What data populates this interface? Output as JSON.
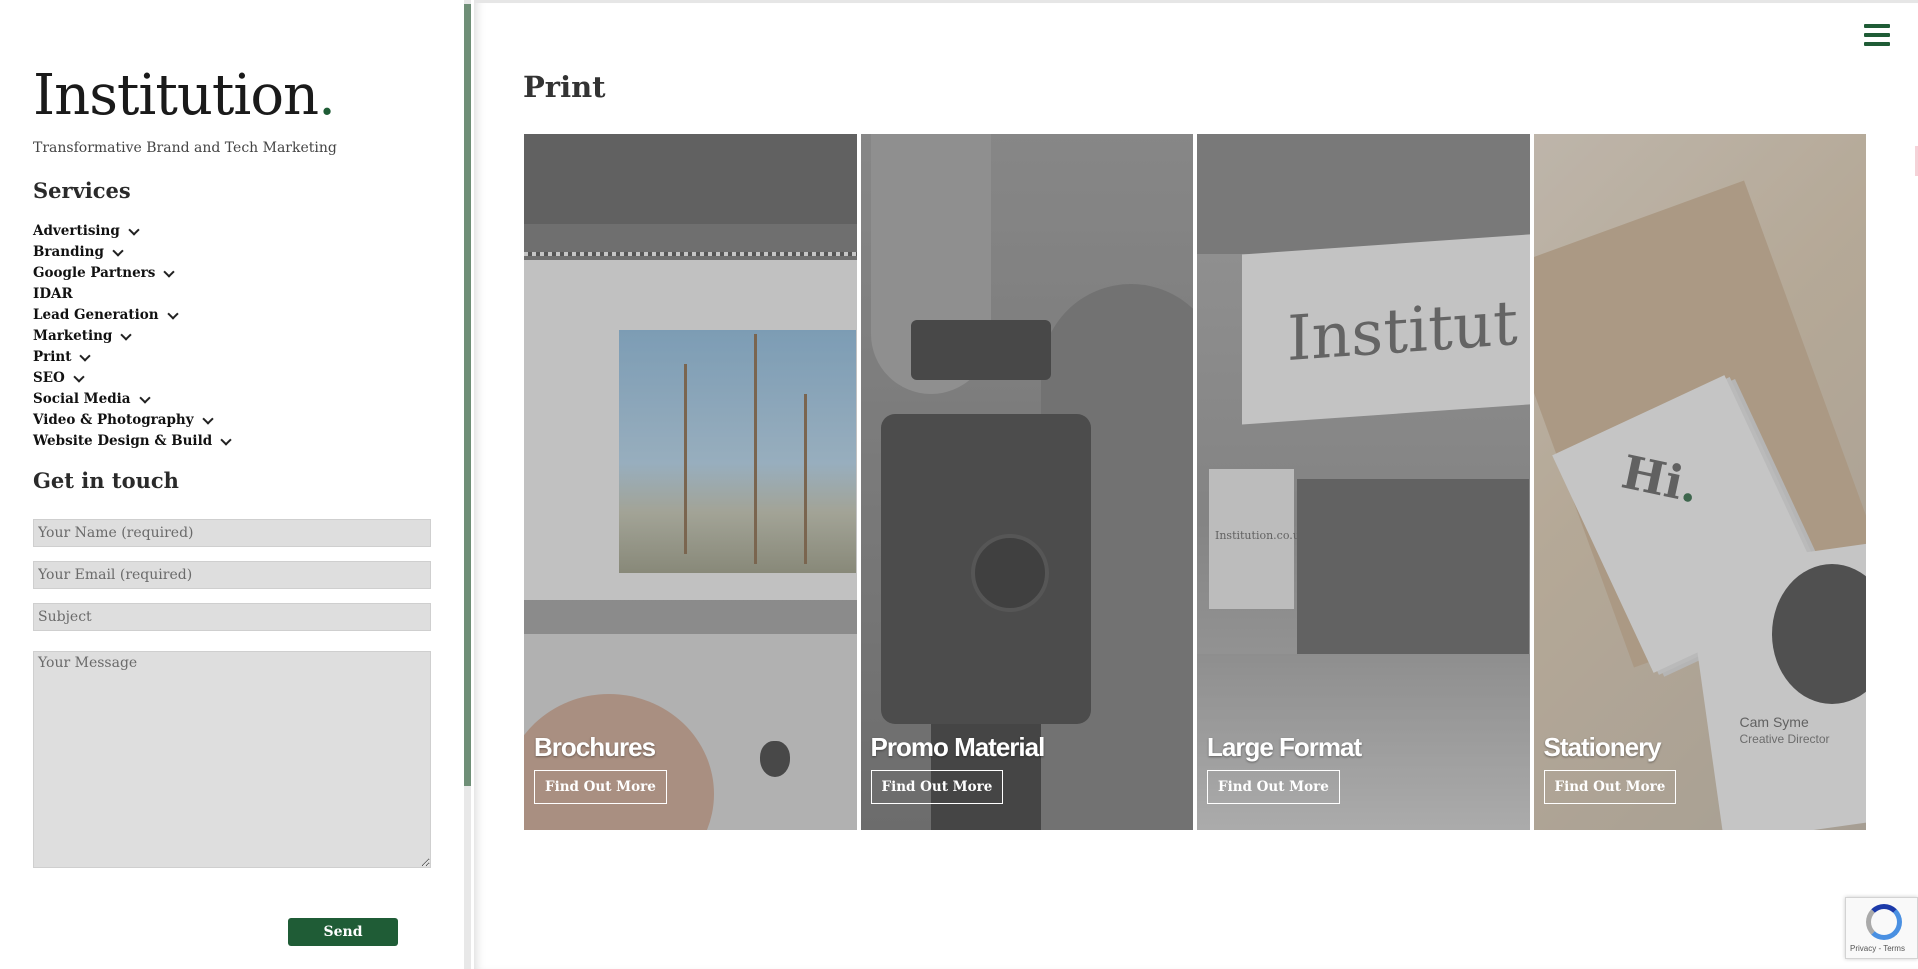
{
  "brand": {
    "name": "Institution",
    "dot": ".",
    "tagline": "Transformative Brand and Tech Marketing"
  },
  "services": {
    "title": "Services",
    "items": [
      {
        "label": "Advertising",
        "has_submenu": true
      },
      {
        "label": "Branding",
        "has_submenu": true
      },
      {
        "label": "Google Partners",
        "has_submenu": true
      },
      {
        "label": "IDAR",
        "has_submenu": false
      },
      {
        "label": "Lead Generation",
        "has_submenu": true
      },
      {
        "label": "Marketing",
        "has_submenu": true
      },
      {
        "label": "Print",
        "has_submenu": true
      },
      {
        "label": "SEO",
        "has_submenu": true
      },
      {
        "label": "Social Media",
        "has_submenu": true
      },
      {
        "label": "Video & Photography",
        "has_submenu": true
      },
      {
        "label": "Website Design & Build",
        "has_submenu": true
      }
    ]
  },
  "contact": {
    "title": "Get in touch",
    "name_placeholder": "Your Name (required)",
    "email_placeholder": "Your Email (required)",
    "subject_placeholder": "Subject",
    "message_placeholder": "Your Message",
    "send_label": "Send"
  },
  "main": {
    "page_title": "Print",
    "cards": [
      {
        "title": "Brochures",
        "button": "Find Out More"
      },
      {
        "title": "Promo Material",
        "button": "Find Out More"
      },
      {
        "title": "Large Format",
        "button": "Find Out More"
      },
      {
        "title": "Stationery",
        "button": "Find Out More"
      }
    ]
  },
  "images": {
    "large_format_sign": "Institut",
    "large_format_side_sign": "Institution.co.uk",
    "stationery_card_greeting": "Hi",
    "stationery_card_dot": ".",
    "stationery_name": "Cam Syme",
    "stationery_role": "Creative Director"
  },
  "recaptcha": {
    "terms": "Privacy - Terms"
  },
  "colors": {
    "accent": "#1f5c36",
    "field_bg": "#dedede"
  }
}
